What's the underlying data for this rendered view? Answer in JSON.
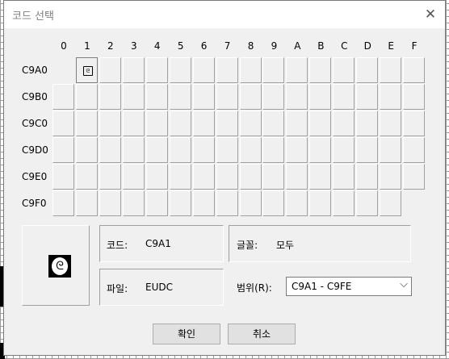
{
  "title": "코드 선택",
  "close_icon": "close-icon",
  "grid": {
    "columns": [
      "0",
      "1",
      "2",
      "3",
      "4",
      "5",
      "6",
      "7",
      "8",
      "9",
      "A",
      "B",
      "C",
      "D",
      "E",
      "F"
    ],
    "rows": [
      "C9A0",
      "C9B0",
      "C9C0",
      "C9D0",
      "C9E0",
      "C9F0"
    ],
    "selected_glyph": "ᘓ"
  },
  "info": {
    "code_label": "코드:",
    "code_value": "C9A1",
    "font_label": "글꼴:",
    "font_value": "모두",
    "file_label": "파일:",
    "file_value": "EUDC",
    "range_label": "범위(R):",
    "range_value": "C9A1 - C9FE"
  },
  "preview_glyph": "ᘓ",
  "buttons": {
    "ok": "확인",
    "cancel": "취소"
  }
}
